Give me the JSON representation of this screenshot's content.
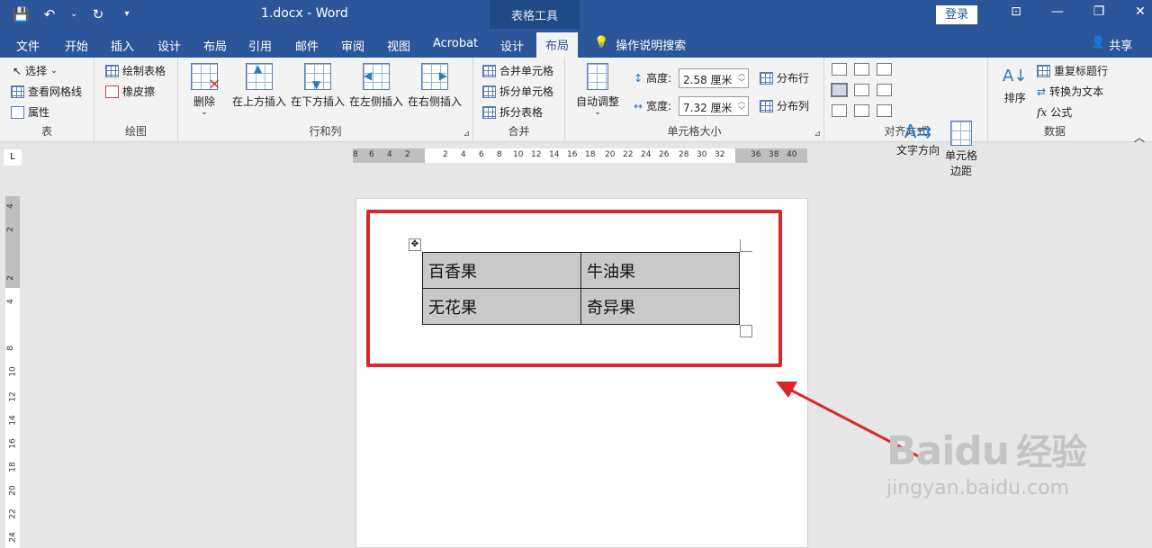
{
  "titlebar": {
    "doc_title": "1.docx  -  Word",
    "contextual_tools": "表格工具",
    "login": "登录",
    "qat_save": "💾",
    "qat_undo": "↶",
    "qat_undo_arrow": "⌄",
    "qat_redo": "↻",
    "qat_more": "▾",
    "ribbon_options": "⊡",
    "minimize": "—",
    "restore": "❐",
    "close": "✕"
  },
  "tabs": [
    {
      "label": "文件"
    },
    {
      "label": "开始"
    },
    {
      "label": "插入"
    },
    {
      "label": "设计"
    },
    {
      "label": "布局"
    },
    {
      "label": "引用"
    },
    {
      "label": "邮件"
    },
    {
      "label": "审阅"
    },
    {
      "label": "视图"
    },
    {
      "label": "Acrobat"
    },
    {
      "label": "设计"
    },
    {
      "label": "布局"
    }
  ],
  "tellme": {
    "icon": "💡",
    "label": "操作说明搜索"
  },
  "share": {
    "icon": "👤",
    "label": "共享"
  },
  "ribbon": {
    "table_group": {
      "label": "表",
      "select": "选择",
      "select_arrow": "⌄",
      "gridlines": "查看网格线",
      "properties": "属性"
    },
    "draw_group": {
      "label": "绘图",
      "draw_table": "绘制表格",
      "eraser": "橡皮擦"
    },
    "rows_cols_group": {
      "label": "行和列",
      "delete": "删除",
      "delete_arrow": "⌄",
      "insert_above": "在上方插入",
      "insert_below": "在下方插入",
      "insert_left": "在左侧插入",
      "insert_right": "在右侧插入"
    },
    "merge_group": {
      "label": "合并",
      "merge_cells": "合并单元格",
      "split_cells": "拆分单元格",
      "split_table": "拆分表格"
    },
    "cell_size_group": {
      "label": "单元格大小",
      "autofit": "自动调整",
      "autofit_arrow": "⌄",
      "height_label": "高度:",
      "height_value": "2.58 厘米",
      "width_label": "宽度:",
      "width_value": "7.32 厘米",
      "dist_rows": "分布行",
      "dist_cols": "分布列"
    },
    "align_group": {
      "label": "对齐方式",
      "text_direction": "文字方向",
      "cell_margins_1": "单元格",
      "cell_margins_2": "边距"
    },
    "data_group": {
      "label": "数据",
      "sort": "排序",
      "repeat_header": "重复标题行",
      "convert_text": "转换为文本",
      "formula": "公式",
      "fx": "fx"
    }
  },
  "ruler": {
    "corner": "L",
    "h_numbers": [
      "8",
      "6",
      "4",
      "2",
      "2",
      "4",
      "6",
      "8",
      "10",
      "12",
      "14",
      "16",
      "18",
      "20",
      "22",
      "24",
      "26",
      "28",
      "30",
      "32",
      "36",
      "38",
      "40"
    ],
    "v_numbers": [
      "4",
      "2",
      "2",
      "4",
      "8",
      "10",
      "12",
      "14",
      "16",
      "18",
      "20",
      "22",
      "24"
    ]
  },
  "table": {
    "rows": [
      [
        "百香果",
        "牛油果"
      ],
      [
        "无花果",
        "奇异果"
      ]
    ]
  },
  "watermark": {
    "logo": "Baidu",
    "logo_cn": "经验",
    "url": "jingyan.baidu.com"
  },
  "colors": {
    "title_bar": "#2b579a",
    "ribbon": "#f3f3f3",
    "highlight": "#d9262a",
    "cell_fill": "#c9c9c9"
  }
}
